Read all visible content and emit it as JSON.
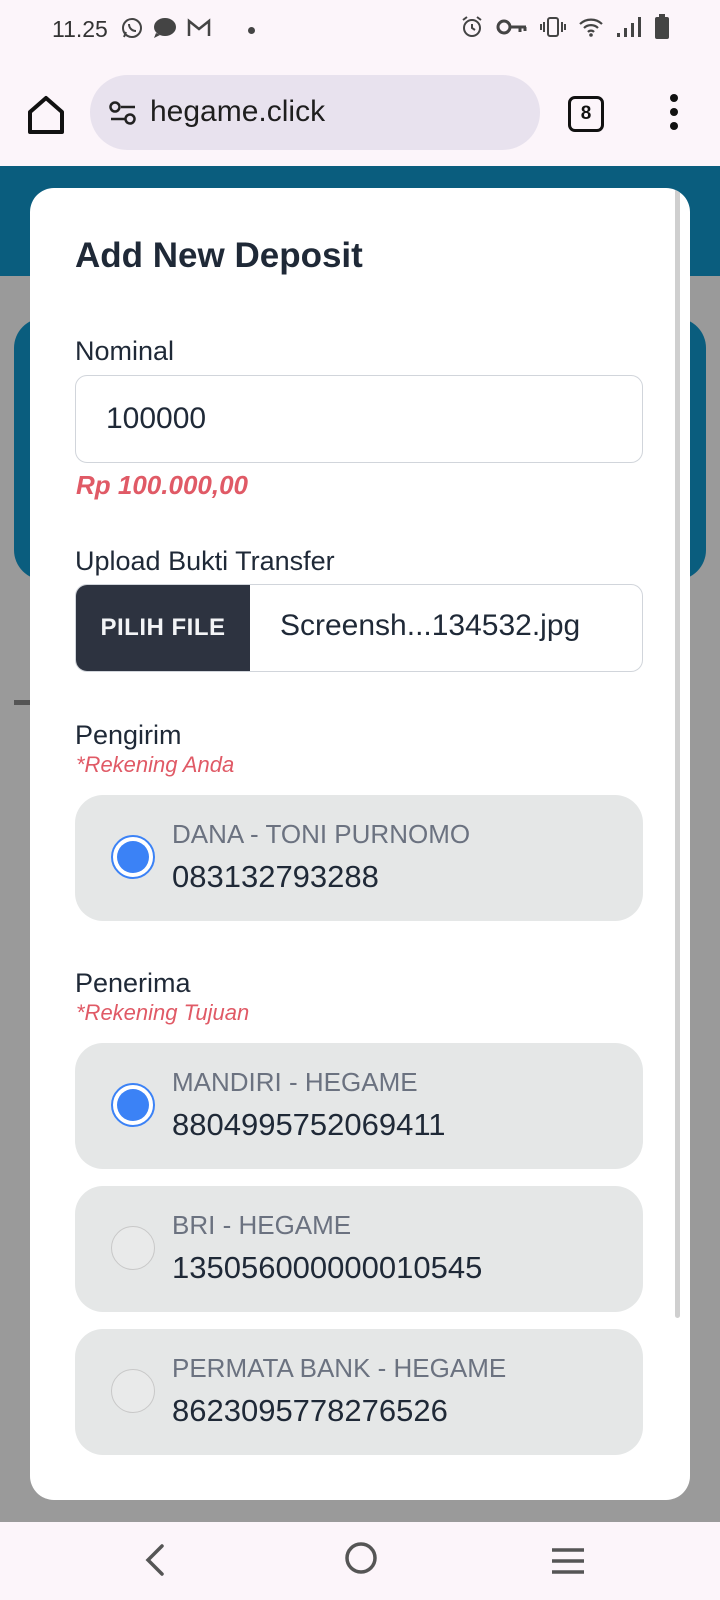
{
  "status_bar": {
    "time": "11.25",
    "icons_left": [
      "whatsapp-icon",
      "chat-bubble-icon",
      "gmail-icon",
      "notification-dot-icon"
    ],
    "icons_right": [
      "alarm-icon",
      "vpn-key-icon",
      "vibrate-icon",
      "wifi-icon",
      "signal-icon",
      "battery-icon"
    ]
  },
  "browser": {
    "url": "hegame.click",
    "tab_count": "8"
  },
  "modal": {
    "title": "Add New Deposit",
    "nominal": {
      "label": "Nominal",
      "value": "100000",
      "formatted": "Rp 100.000,00"
    },
    "upload": {
      "label": "Upload Bukti Transfer",
      "button_label": "PILIH FILE",
      "file_name": "Screensh...134532.jpg"
    },
    "sender": {
      "label": "Pengirim",
      "note": "*Rekening Anda",
      "options": [
        {
          "name": "DANA - TONI PURNOMO",
          "number": "083132793288",
          "selected": true
        }
      ]
    },
    "recipient": {
      "label": "Penerima",
      "note": "*Rekening Tujuan",
      "options": [
        {
          "name": "MANDIRI - HEGAME",
          "number": "8804995752069411",
          "selected": true
        },
        {
          "name": "BRI - HEGAME",
          "number": "135056000000010545",
          "selected": false
        },
        {
          "name": "PERMATA BANK - HEGAME",
          "number": "8623095778276526",
          "selected": false
        }
      ]
    }
  },
  "colors": {
    "accent_blue": "#3b82f6",
    "error_red": "#e05a66",
    "site_teal": "#0a5d7e",
    "button_dark": "#2d3340"
  }
}
